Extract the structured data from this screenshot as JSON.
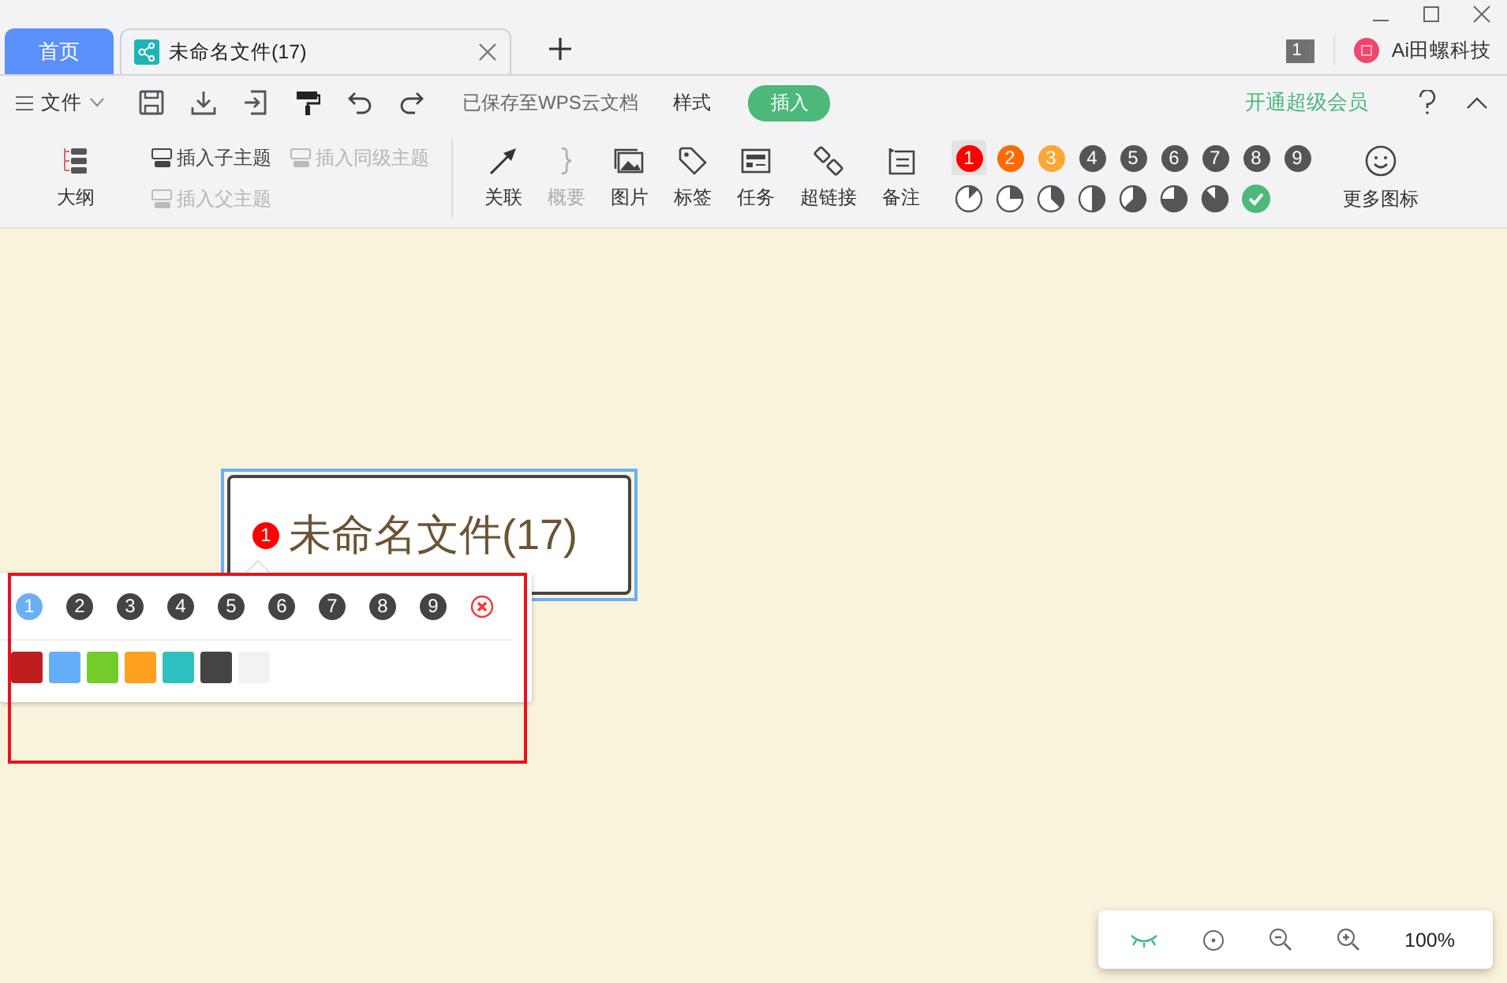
{
  "tabs": [
    {
      "kind": "home",
      "label": "首页",
      "selected": false
    },
    {
      "kind": "document",
      "label": "未命名文件(17)",
      "selected": true
    }
  ],
  "account": {
    "badge": "1",
    "name": "Ai田螺科技"
  },
  "menu": {
    "file": "文件",
    "saved_status": "已保存至WPS云文档",
    "vip": "开通超级会员",
    "tabs": [
      {
        "label": "样式",
        "selected": false
      },
      {
        "label": "插入",
        "selected": true
      }
    ]
  },
  "toolbar": {
    "outline": "大纲",
    "topic_buttons": [
      {
        "label": "插入子主题",
        "disabled": false
      },
      {
        "label": "插入同级主题",
        "disabled": true
      },
      {
        "label": "插入父主题",
        "disabled": true
      }
    ],
    "tools": [
      {
        "label": "关联",
        "disabled": false
      },
      {
        "label": "概要",
        "disabled": true
      },
      {
        "label": "图片",
        "disabled": false
      },
      {
        "label": "标签",
        "disabled": false
      },
      {
        "label": "任务",
        "disabled": false
      },
      {
        "label": "超链接",
        "disabled": false
      },
      {
        "label": "备注",
        "disabled": false
      }
    ],
    "priorities": [
      {
        "label": "1",
        "color": "#ff0000",
        "selected": true
      },
      {
        "label": "2",
        "color": "#ff6a00",
        "selected": false
      },
      {
        "label": "3",
        "color": "#ffa733",
        "selected": false
      },
      {
        "label": "4",
        "color": "#555555",
        "selected": false
      },
      {
        "label": "5",
        "color": "#555555",
        "selected": false
      },
      {
        "label": "6",
        "color": "#555555",
        "selected": false
      },
      {
        "label": "7",
        "color": "#555555",
        "selected": false
      },
      {
        "label": "8",
        "color": "#555555",
        "selected": false
      },
      {
        "label": "9",
        "color": "#555555",
        "selected": false
      }
    ],
    "progress": [
      {
        "kind": "eighth"
      },
      {
        "kind": "quarter"
      },
      {
        "kind": "threeeighths"
      },
      {
        "kind": "half"
      },
      {
        "kind": "fiveeighths"
      },
      {
        "kind": "threequarters"
      },
      {
        "kind": "seveneighths"
      },
      {
        "kind": "done"
      }
    ],
    "more_icons": "更多图标"
  },
  "canvas": {
    "node": {
      "title": "未命名文件(17)",
      "priority": "1",
      "selected": true
    },
    "popup": {
      "priorities": [
        {
          "label": "1",
          "selected": true
        },
        {
          "label": "2",
          "selected": false
        },
        {
          "label": "3",
          "selected": false
        },
        {
          "label": "4",
          "selected": false
        },
        {
          "label": "5",
          "selected": false
        },
        {
          "label": "6",
          "selected": false
        },
        {
          "label": "7",
          "selected": false
        },
        {
          "label": "8",
          "selected": false
        },
        {
          "label": "9",
          "selected": false
        }
      ],
      "colors": [
        {
          "color": "#be1e1e"
        },
        {
          "color": "#66adf7"
        },
        {
          "color": "#73cc2a"
        },
        {
          "color": "#ffa11e"
        },
        {
          "color": "#2fc1c0"
        },
        {
          "color": "#444444"
        },
        {
          "color": "#f2f2f2"
        }
      ]
    }
  },
  "zoom_bar": {
    "zoom": "100%"
  }
}
